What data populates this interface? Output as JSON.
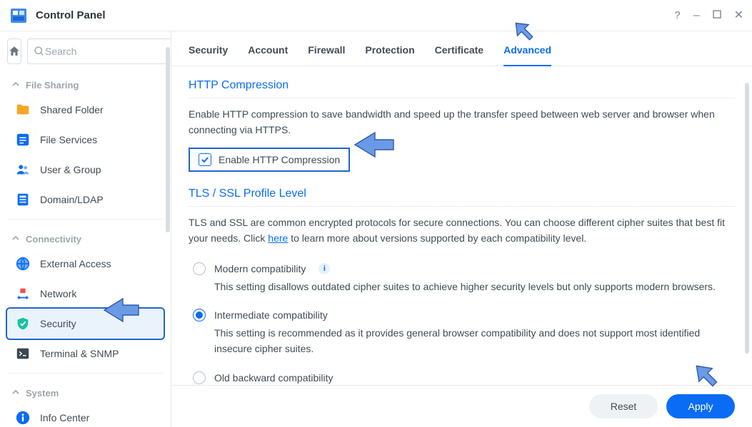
{
  "window": {
    "title": "Control Panel"
  },
  "search": {
    "placeholder": "Search"
  },
  "sidebar": {
    "groups": [
      {
        "label": "File Sharing"
      },
      {
        "label": "Connectivity"
      },
      {
        "label": "System"
      }
    ],
    "items": {
      "shared_folder": "Shared Folder",
      "file_services": "File Services",
      "user_group": "User & Group",
      "domain_ldap": "Domain/LDAP",
      "external_access": "External Access",
      "network": "Network",
      "security": "Security",
      "terminal_snmp": "Terminal & SNMP",
      "info_center": "Info Center"
    }
  },
  "tabs": {
    "security": "Security",
    "account": "Account",
    "firewall": "Firewall",
    "protection": "Protection",
    "certificate": "Certificate",
    "advanced": "Advanced"
  },
  "http_compression": {
    "title": "HTTP Compression",
    "desc": "Enable HTTP compression to save bandwidth and speed up the transfer speed between web server and browser when connecting via HTTPS.",
    "checkbox_label": "Enable HTTP Compression",
    "checked": true
  },
  "tls": {
    "title": "TLS / SSL Profile Level",
    "desc_pre": "TLS and SSL are common encrypted protocols for secure connections. You can choose different cipher suites that best fit your needs. Click ",
    "desc_link": "here",
    "desc_post": " to learn more about versions supported by each compatibility level.",
    "options": {
      "modern": {
        "label": "Modern compatibility",
        "desc": "This setting disallows outdated cipher suites to achieve higher security levels but only supports modern browsers."
      },
      "intermediate": {
        "label": "Intermediate compatibility",
        "desc": "This setting is recommended as it provides general browser compatibility and does not support most identified insecure cipher suites."
      },
      "old": {
        "label": "Old backward compatibility"
      }
    },
    "selected": "intermediate"
  },
  "footer": {
    "reset": "Reset",
    "apply": "Apply"
  }
}
